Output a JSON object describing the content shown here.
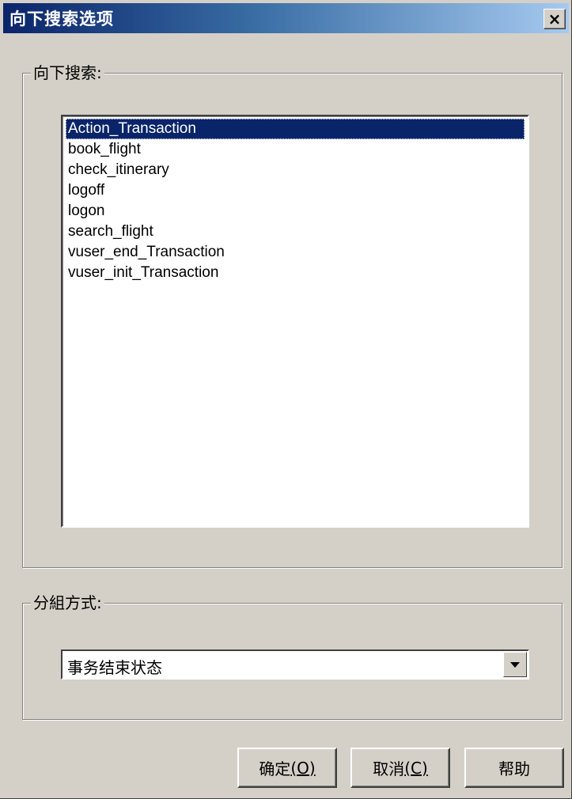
{
  "window": {
    "title": "向下搜索选项",
    "close_glyph": "×"
  },
  "search_group": {
    "legend": "向下搜索:",
    "items": [
      "Action_Transaction",
      "book_flight",
      "check_itinerary",
      "logoff",
      "logon",
      "search_flight",
      "vuser_end_Transaction",
      "vuser_init_Transaction"
    ],
    "selected_index": 0
  },
  "group_by": {
    "legend": "分組方式:",
    "selected_value": "事务结束状态"
  },
  "buttons": {
    "ok_label": "确定",
    "ok_accel": "(O)",
    "cancel_label": "取消",
    "cancel_accel": "(C)",
    "help_label": "帮助"
  },
  "colors": {
    "title_bar_start": "#0a246a",
    "title_bar_end": "#a6caf0",
    "selection": "#0a246a",
    "dialog_bg": "#d4d0c8"
  }
}
